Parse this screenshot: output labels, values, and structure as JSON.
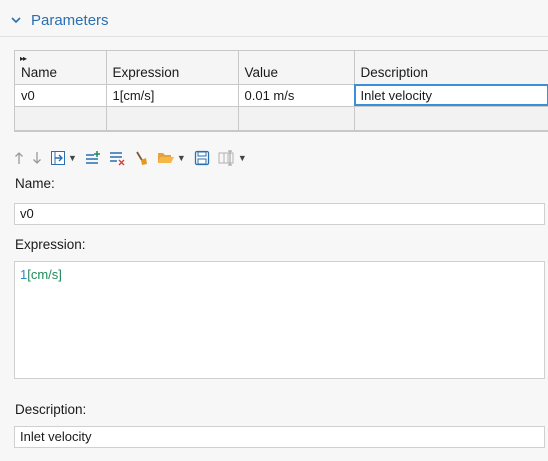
{
  "section": {
    "title": "Parameters",
    "icon": "chevron-down-icon"
  },
  "table": {
    "columns": [
      "Name",
      "Expression",
      "Value",
      "Description"
    ],
    "rows": [
      {
        "name": "v0",
        "expression": "1[cm/s]",
        "value": "0.01 m/s",
        "description": "Inlet velocity"
      }
    ]
  },
  "toolbar": {
    "icons": [
      "move-up-icon",
      "move-down-icon",
      "insert-column-icon",
      "add-row-icon",
      "delete-rows-icon",
      "clear-table-icon",
      "load-from-file-icon",
      "save-to-file-icon",
      "column-settings-icon"
    ]
  },
  "form": {
    "name_label": "Name:",
    "name_value": "v0",
    "expression_label": "Expression:",
    "expression_number": "1",
    "expression_unit": "[cm/s]",
    "description_label": "Description:",
    "description_value": "Inlet velocity"
  },
  "colors": {
    "accent": "#2a6fb0",
    "selection": "#3b8fd9",
    "unit": "#1f8a5a",
    "number": "#2a8ac4"
  }
}
